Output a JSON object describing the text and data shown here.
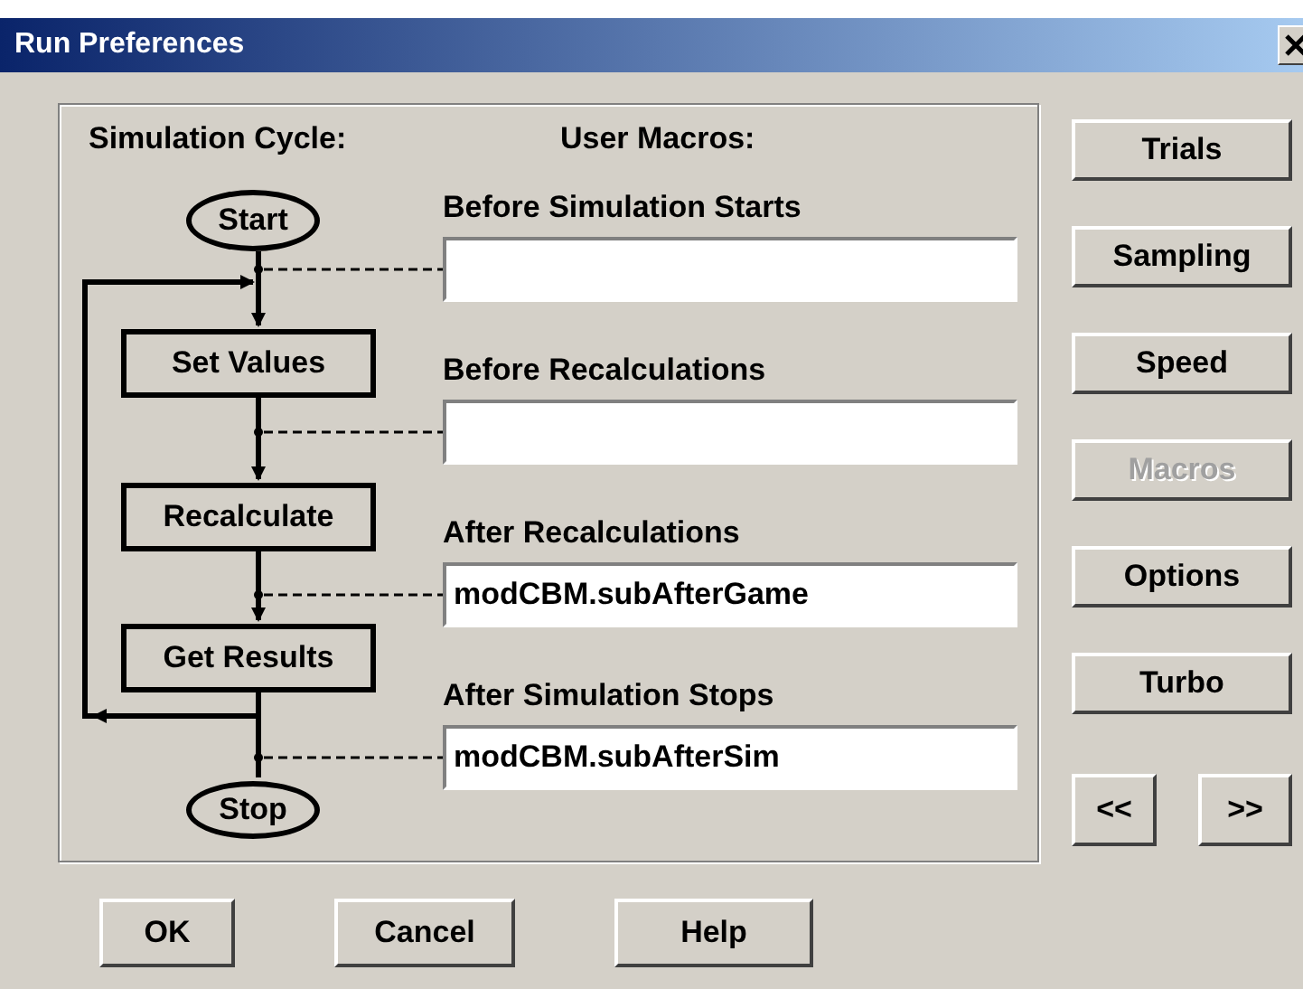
{
  "window": {
    "title": "Run Preferences"
  },
  "headings": [
    "Simulation Cycle:",
    "User Macros:"
  ],
  "flowchart": {
    "nodes": [
      {
        "kind": "terminal",
        "label": "Start"
      },
      {
        "kind": "step",
        "label": "Set Values"
      },
      {
        "kind": "step",
        "label": "Recalculate"
      },
      {
        "kind": "step",
        "label": "Get Results"
      },
      {
        "kind": "terminal",
        "label": "Stop"
      }
    ]
  },
  "macros": [
    {
      "label": "Before Simulation Starts"
    },
    {
      "label": "Before Recalculations"
    },
    {
      "label": "After Recalculations",
      "value": "modCBM.subAfterGame"
    },
    {
      "label": "After Simulation Stops",
      "value": "modCBM.subAfterSim"
    }
  ],
  "side_buttons": [
    {
      "label": "Trials",
      "disabled": false
    },
    {
      "label": "Sampling",
      "disabled": false
    },
    {
      "label": "Speed",
      "disabled": false
    },
    {
      "label": "Macros",
      "disabled": true
    },
    {
      "label": "Options",
      "disabled": false
    },
    {
      "label": "Turbo",
      "disabled": false
    }
  ],
  "nav_buttons": [
    "<<",
    ">>"
  ],
  "buttons": [
    "OK",
    "Cancel",
    "Help"
  ]
}
